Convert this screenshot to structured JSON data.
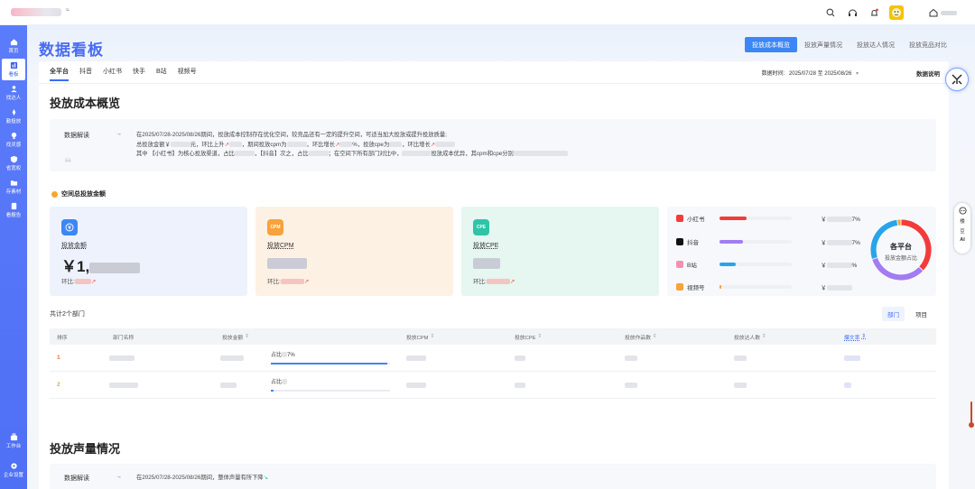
{
  "topbar": {
    "logo_text": "≈"
  },
  "sidebar": {
    "items": [
      {
        "label": "首页",
        "icon": "home-icon"
      },
      {
        "label": "看板",
        "icon": "dashboard-icon"
      },
      {
        "label": "找达人",
        "icon": "user-search-icon"
      },
      {
        "label": "勤投放",
        "icon": "rocket-icon"
      },
      {
        "label": "找灵感",
        "icon": "bulb-icon"
      },
      {
        "label": "省宽权",
        "icon": "shield-icon"
      },
      {
        "label": "存素材",
        "icon": "folder-icon"
      },
      {
        "label": "看报告",
        "icon": "report-icon"
      }
    ],
    "bottom_items": [
      {
        "label": "工作台",
        "icon": "workbench-icon"
      },
      {
        "label": "企业设置",
        "icon": "settings-icon"
      }
    ]
  },
  "page": {
    "title": "数据看板",
    "top_tabs": [
      "投放成本概览",
      "投放声量情况",
      "投放达人情况",
      "投放竞品对比"
    ],
    "active_top_tab": 0,
    "platform_tabs": [
      "全平台",
      "抖音",
      "小红书",
      "快手",
      "B站",
      "视频号"
    ],
    "active_platform_tab": 0,
    "date_label": "数据时间:",
    "date_range": "2025/07/28 至 2025/08/26",
    "explain_label": "数据说明"
  },
  "overview": {
    "section_title": "投放成本概览",
    "interp_label": "数据解读",
    "interp_arrow": "→",
    "line1": "在2025/07/28-2025/08/26期间，投放成本控制存在优化空间，较竞品还有一定的提升空间，可适当加大投放或提升投放质量;",
    "line2_a": "总投放金额￥",
    "line2_b": "元，环比上升",
    "line2_c": "，期间投放cpm为",
    "line2_d": "，环比增长",
    "line2_e": "%，投放cpe为",
    "line2_f": "，环比增长",
    "line3_a": "其中 【小红书】为核心投放渠道，占比",
    "line3_b": "，【抖音】次之，占比",
    "line3_c": "；在空间下所有部门对比中，",
    "line3_d": "投放成本优异，其cpm和cpe分别"
  },
  "total_spend": {
    "title": "空间总投放金额",
    "metrics": [
      {
        "label": "投放金额",
        "value": "￥1,",
        "change_label": "环比:",
        "icon_text": "¥",
        "color": "#3d86f5",
        "bg": "#eef2fd"
      },
      {
        "label": "投放CPM",
        "value": "",
        "change_label": "环比:",
        "icon_text": "CPM",
        "color": "#f7a23b",
        "bg": "#fdf1e4"
      },
      {
        "label": "投放CPE",
        "value": "",
        "change_label": "环比:",
        "icon_text": "CPE",
        "color": "#2ec4a8",
        "bg": "#e6f6f1"
      }
    ]
  },
  "platform_share": {
    "rows": [
      {
        "name": "小红书",
        "icon_color": "#f23b3b",
        "bar_color": "#f23b3b",
        "fill": 0.37,
        "value_prefix": "￥",
        "value_suffix": "7%"
      },
      {
        "name": "抖音",
        "icon_color": "#111111",
        "bar_color": "#a27cf2",
        "fill": 0.32,
        "value_prefix": "￥",
        "value_suffix": "7%"
      },
      {
        "name": "B站",
        "icon_color": "#f58fb0",
        "bar_color": "#2aa4e8",
        "fill": 0.22,
        "value_prefix": "￥",
        "value_suffix": "%"
      },
      {
        "name": "视频号",
        "icon_color": "#f7a23b",
        "bar_color": "#f7a23b",
        "fill": 0.02,
        "value_prefix": "￥",
        "value_suffix": ""
      }
    ],
    "donut_title": "各平台",
    "donut_subtitle": "投放金额占比",
    "donut_segments": [
      {
        "platform": "小红书",
        "share": 0.37,
        "color": "#f23b3b"
      },
      {
        "platform": "抖音",
        "share": 0.33,
        "color": "#a27cf2"
      },
      {
        "platform": "B站",
        "share": 0.28,
        "color": "#2aa4e8"
      },
      {
        "platform": "视频号",
        "share": 0.02,
        "color": "#f7a23b"
      }
    ]
  },
  "departments": {
    "count_text": "共计2个部门",
    "view_tabs": [
      "部门",
      "项目"
    ],
    "active_view_tab": 0,
    "columns": [
      "排序",
      "部门名称",
      "投放金额",
      "投放CPM",
      "投放CPE",
      "投放作品数",
      "投放达人数",
      "爆文率"
    ],
    "rows": [
      {
        "rank": "1",
        "share_text": "占比",
        "share_suffix": "7%",
        "share": 0.98
      },
      {
        "rank": "2",
        "share_text": "占比",
        "share_suffix": "",
        "share": 0.02
      }
    ]
  },
  "voice": {
    "section_title": "投放声量情况",
    "interp_label": "数据解读",
    "interp_arrow": "→",
    "line1": "在2025/07/28-2025/08/26期间，整体声量有所下降"
  },
  "right_float": {
    "label_top": "楼",
    "label_mid": "豆",
    "label_ai": "AI"
  }
}
